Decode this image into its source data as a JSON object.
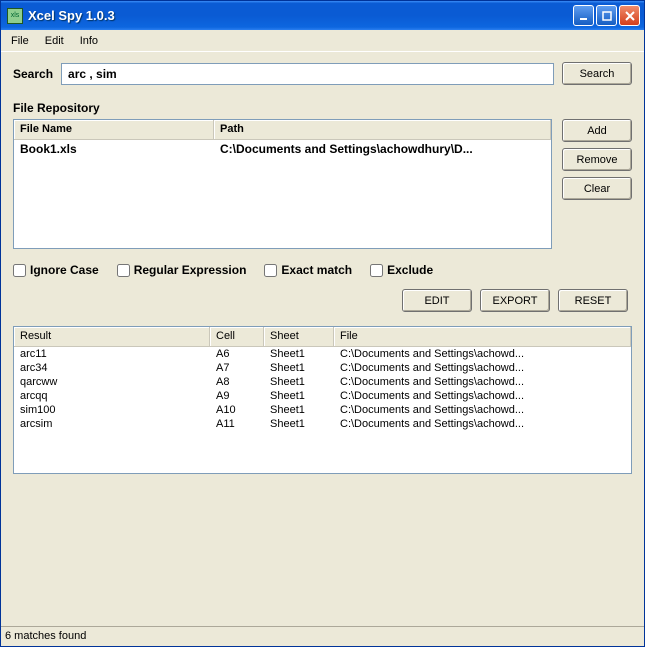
{
  "window": {
    "title": "Xcel Spy 1.0.3"
  },
  "menu": {
    "file": "File",
    "edit": "Edit",
    "info": "Info"
  },
  "search": {
    "label": "Search",
    "value": "arc , sim",
    "button": "Search"
  },
  "repo": {
    "title": "File Repository",
    "headers": {
      "name": "File Name",
      "path": "Path"
    },
    "rows": [
      {
        "name": "Book1.xls",
        "path": "C:\\Documents and Settings\\achowdhury\\D..."
      }
    ],
    "buttons": {
      "add": "Add",
      "remove": "Remove",
      "clear": "Clear"
    }
  },
  "options": {
    "ignoreCase": "Ignore Case",
    "regex": "Regular Expression",
    "exact": "Exact match",
    "exclude": "Exclude"
  },
  "actions": {
    "edit": "EDIT",
    "export": "EXPORT",
    "reset": "RESET"
  },
  "results": {
    "headers": {
      "result": "Result",
      "cell": "Cell",
      "sheet": "Sheet",
      "file": "File"
    },
    "rows": [
      {
        "result": "arc11",
        "cell": "A6",
        "sheet": "Sheet1",
        "file": "C:\\Documents and Settings\\achowd..."
      },
      {
        "result": "arc34",
        "cell": "A7",
        "sheet": "Sheet1",
        "file": "C:\\Documents and Settings\\achowd..."
      },
      {
        "result": "qarcww",
        "cell": "A8",
        "sheet": "Sheet1",
        "file": "C:\\Documents and Settings\\achowd..."
      },
      {
        "result": "arcqq",
        "cell": "A9",
        "sheet": "Sheet1",
        "file": "C:\\Documents and Settings\\achowd..."
      },
      {
        "result": "sim100",
        "cell": "A10",
        "sheet": "Sheet1",
        "file": "C:\\Documents and Settings\\achowd..."
      },
      {
        "result": "arcsim",
        "cell": "A11",
        "sheet": "Sheet1",
        "file": "C:\\Documents and Settings\\achowd..."
      }
    ]
  },
  "status": "6 matches found"
}
